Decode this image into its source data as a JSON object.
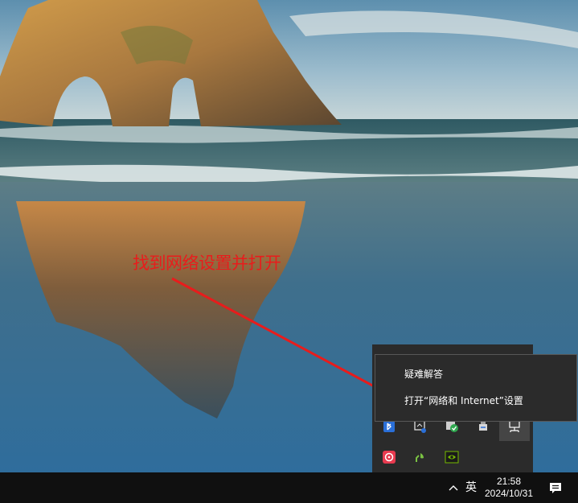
{
  "annotation": {
    "instruction_text": "找到网络设置并打开"
  },
  "context_menu": {
    "items": [
      {
        "label": "疑难解答"
      },
      {
        "label": "打开“网络和 Internet”设置"
      }
    ]
  },
  "tray_overflow": {
    "icons": [
      "bluetooth-icon",
      "display-tool-icon",
      "security-check-icon",
      "usb-device-icon",
      "network-icon",
      "netease-music-icon",
      "app-leaf-icon",
      "nvidia-icon"
    ]
  },
  "taskbar": {
    "ime_indicator": "英",
    "time": "21:58",
    "date": "2024/10/31"
  },
  "colors": {
    "annotation": "#e81c1c",
    "menu_bg": "#2b2b2b",
    "taskbar_bg": "#101010"
  }
}
